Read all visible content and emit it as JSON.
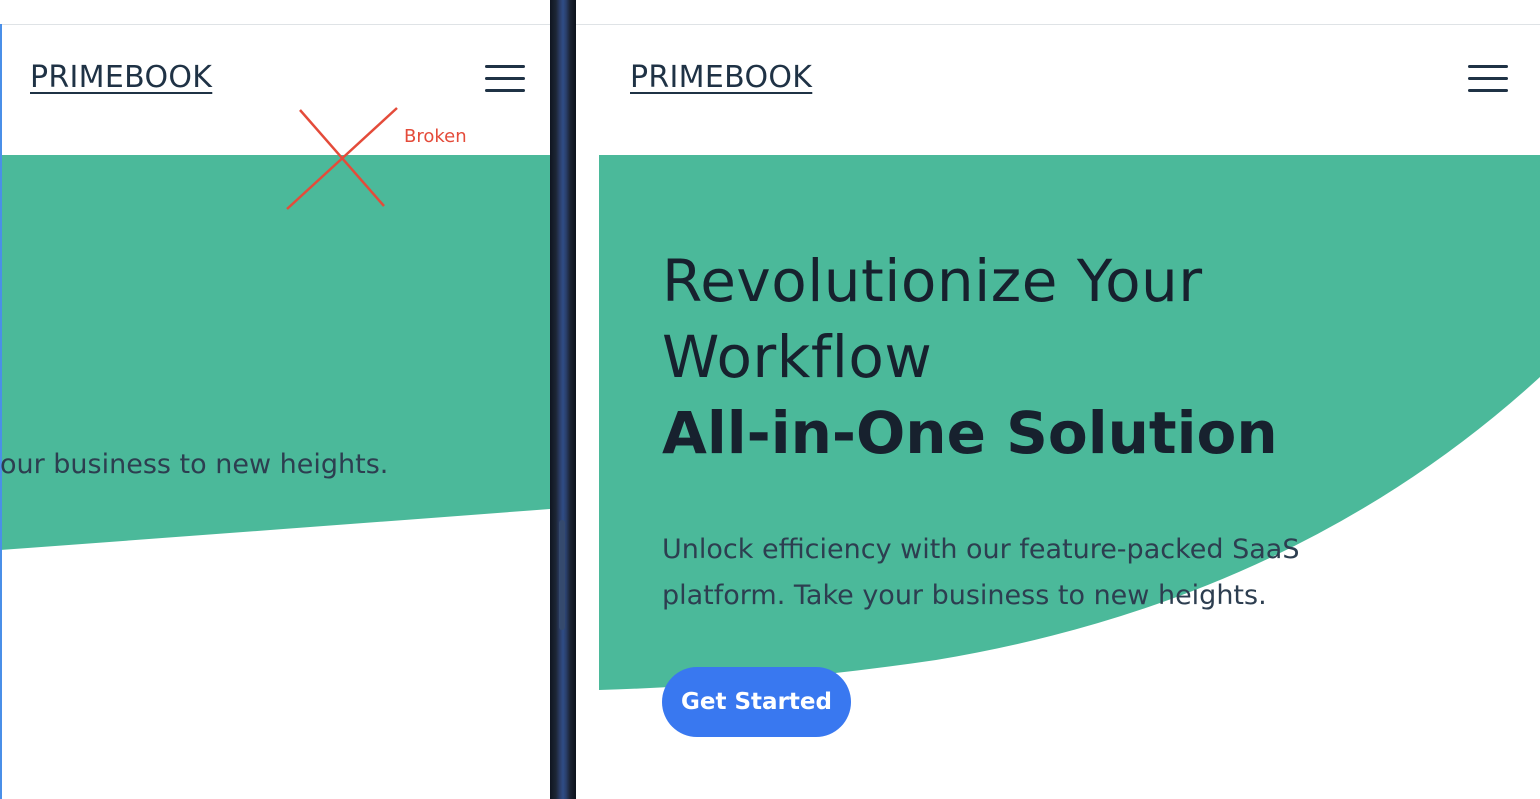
{
  "left_panel": {
    "brand": "PRIMEBOOK",
    "hero_tagline": "your business to new heights.",
    "annotation": "Broken",
    "menu_icon": "hamburger-menu-icon"
  },
  "right_panel": {
    "brand": "PRIMEBOOK",
    "menu_icon": "hamburger-menu-icon",
    "hero": {
      "heading_line1": "Revolutionize Your",
      "heading_line2": "Workflow",
      "heading_strong": "All-in-One Solution",
      "subtitle": "Unlock efficiency with our feature-packed SaaS platform. Take your business to new heights.",
      "cta_label": "Get Started"
    }
  },
  "colors": {
    "hero_green": "#4bb99a",
    "brand_text": "#1f3245",
    "cta_blue": "#3978f0",
    "annotation_red": "#e44b3a"
  }
}
